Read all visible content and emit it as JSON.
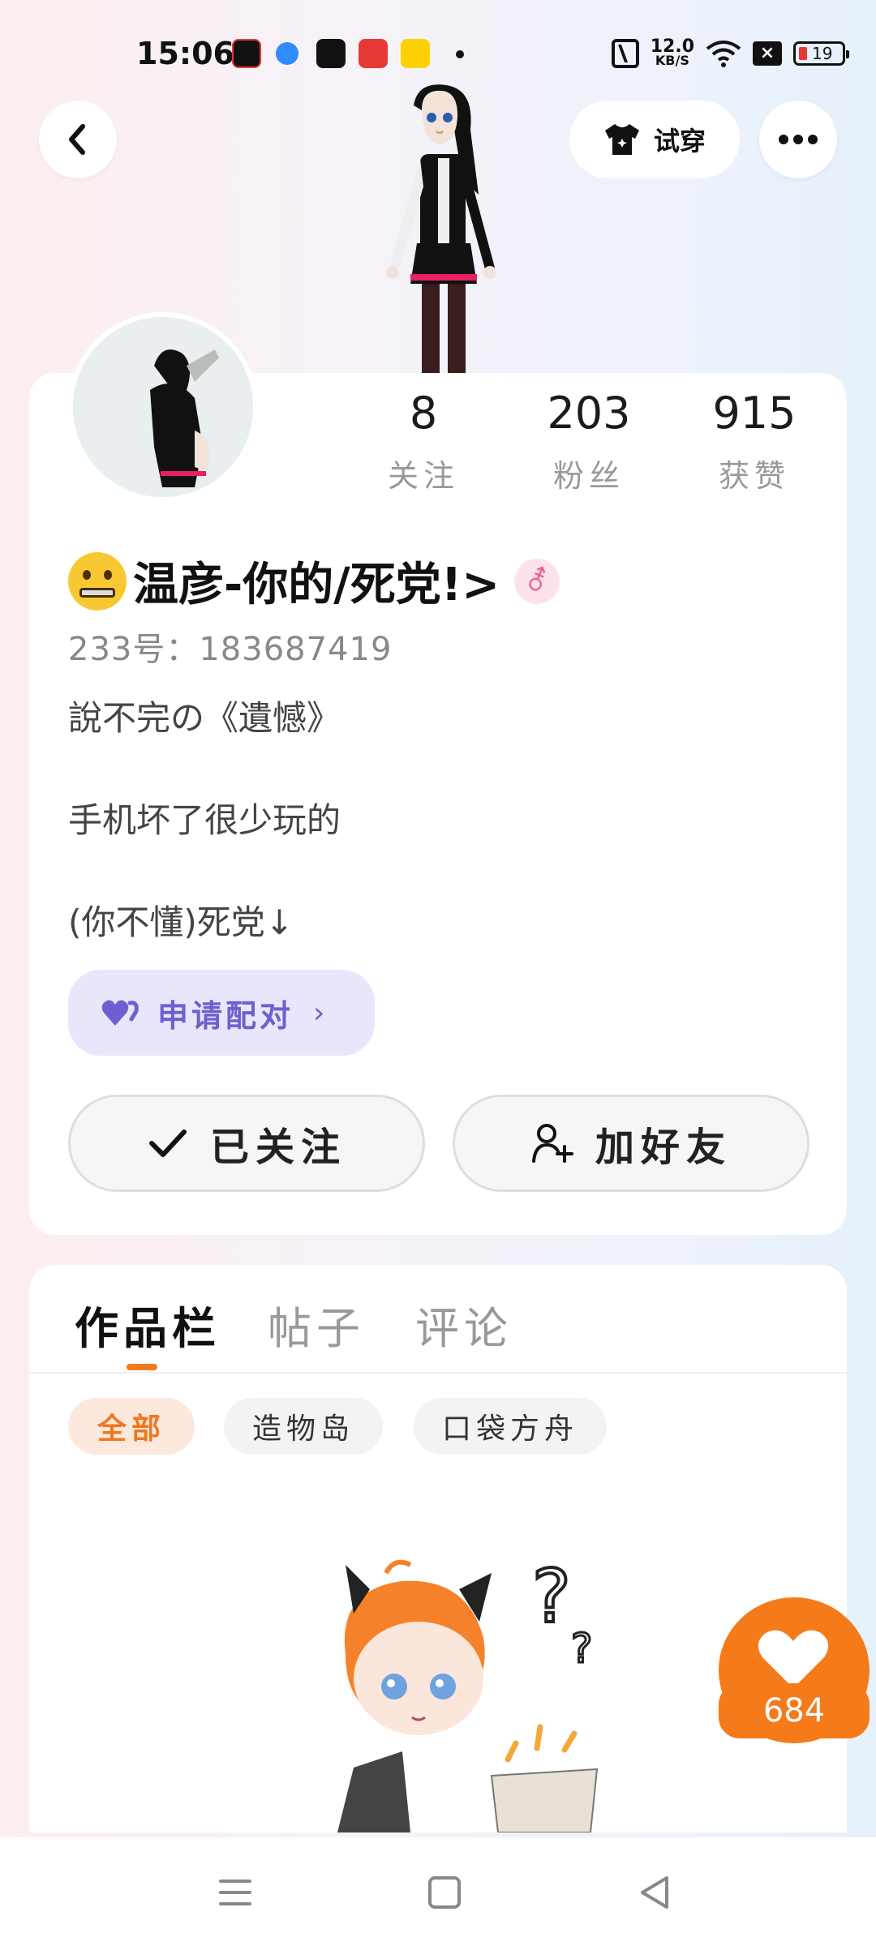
{
  "status_bar": {
    "time": "15:06",
    "net_speed_value": "12.0",
    "net_speed_unit": "KB/S",
    "battery": "19"
  },
  "header": {
    "tryon_label": "试穿"
  },
  "profile": {
    "stats": [
      {
        "value": "8",
        "label": "关注"
      },
      {
        "value": "203",
        "label": "粉丝"
      },
      {
        "value": "915",
        "label": "获赞"
      }
    ],
    "username": "温彦-你的/死党!>",
    "gender_symbol": "⚦",
    "uid": "233号：183687419",
    "bio_lines": [
      "說不完の《遺憾》",
      "手机坏了很少玩的",
      "(你不懂)死党↓"
    ],
    "pair_label": "申请配对",
    "followed_label": "已关注",
    "add_friend_label": "加好友"
  },
  "works": {
    "tabs": [
      "作品栏",
      "帖子",
      "评论"
    ],
    "active_tab": "作品栏",
    "chips": [
      "全部",
      "造物岛",
      "口袋方舟"
    ],
    "active_chip": "全部"
  },
  "like": {
    "count": "684"
  },
  "colors": {
    "accent_orange": "#f57a1a",
    "pair_purple": "#6e5fd0",
    "gender_pink": "#f06292"
  }
}
